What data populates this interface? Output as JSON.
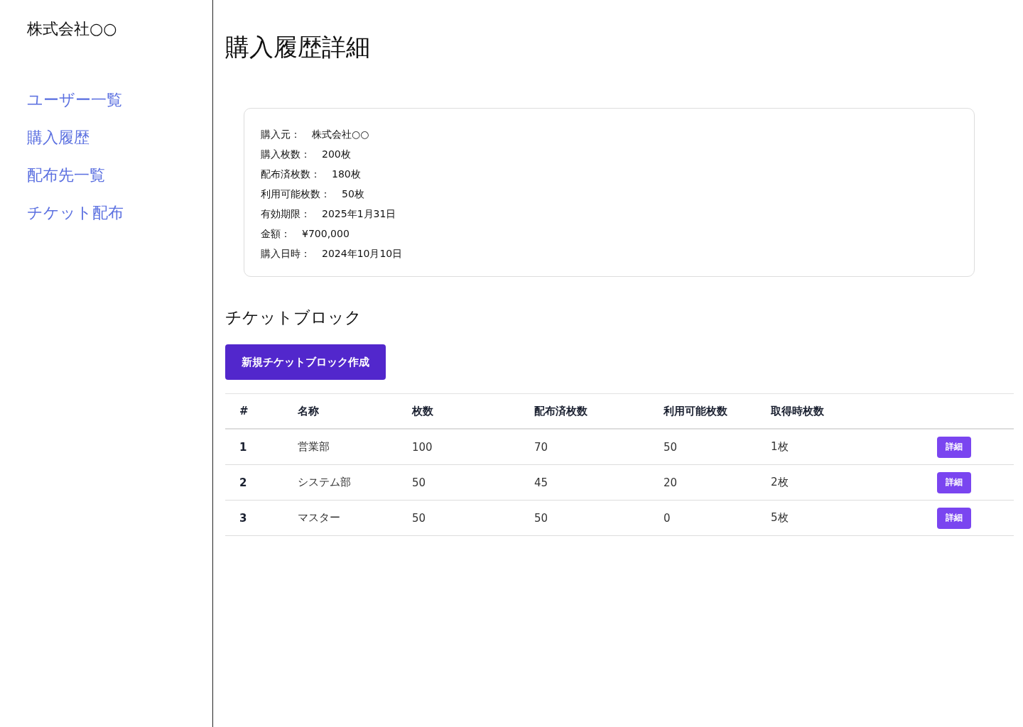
{
  "sidebar": {
    "company": "株式会社○○",
    "items": [
      {
        "label": "ユーザー一覧"
      },
      {
        "label": "購入履歴"
      },
      {
        "label": "配布先一覧"
      },
      {
        "label": "チケット配布"
      }
    ]
  },
  "page_title": "購入履歴詳細",
  "details": [
    {
      "label": "購入元：",
      "value": "株式会社○○"
    },
    {
      "label": "購入枚数：",
      "value": "200枚"
    },
    {
      "label": "配布済枚数：",
      "value": "180枚"
    },
    {
      "label": "利用可能枚数：",
      "value": "50枚"
    },
    {
      "label": "有効期限：",
      "value": "2025年1月31日"
    },
    {
      "label": "金額：",
      "value": "¥700,000"
    },
    {
      "label": "購入日時：",
      "value": "2024年10月10日"
    }
  ],
  "section_title": "チケットブロック",
  "create_button": "新規チケットブロック作成",
  "table": {
    "columns": [
      "#",
      "名称",
      "枚数",
      "配布済枚数",
      "利用可能枚数",
      "取得時枚数"
    ],
    "rows": [
      {
        "cells": [
          "1",
          "営業部",
          "100",
          "70",
          "50",
          "1枚"
        ],
        "action": "詳細"
      },
      {
        "cells": [
          "2",
          "システム部",
          "50",
          "45",
          "20",
          "2枚"
        ],
        "action": "詳細"
      },
      {
        "cells": [
          "3",
          "マスター",
          "50",
          "50",
          "0",
          "5枚"
        ],
        "action": "詳細"
      }
    ]
  }
}
